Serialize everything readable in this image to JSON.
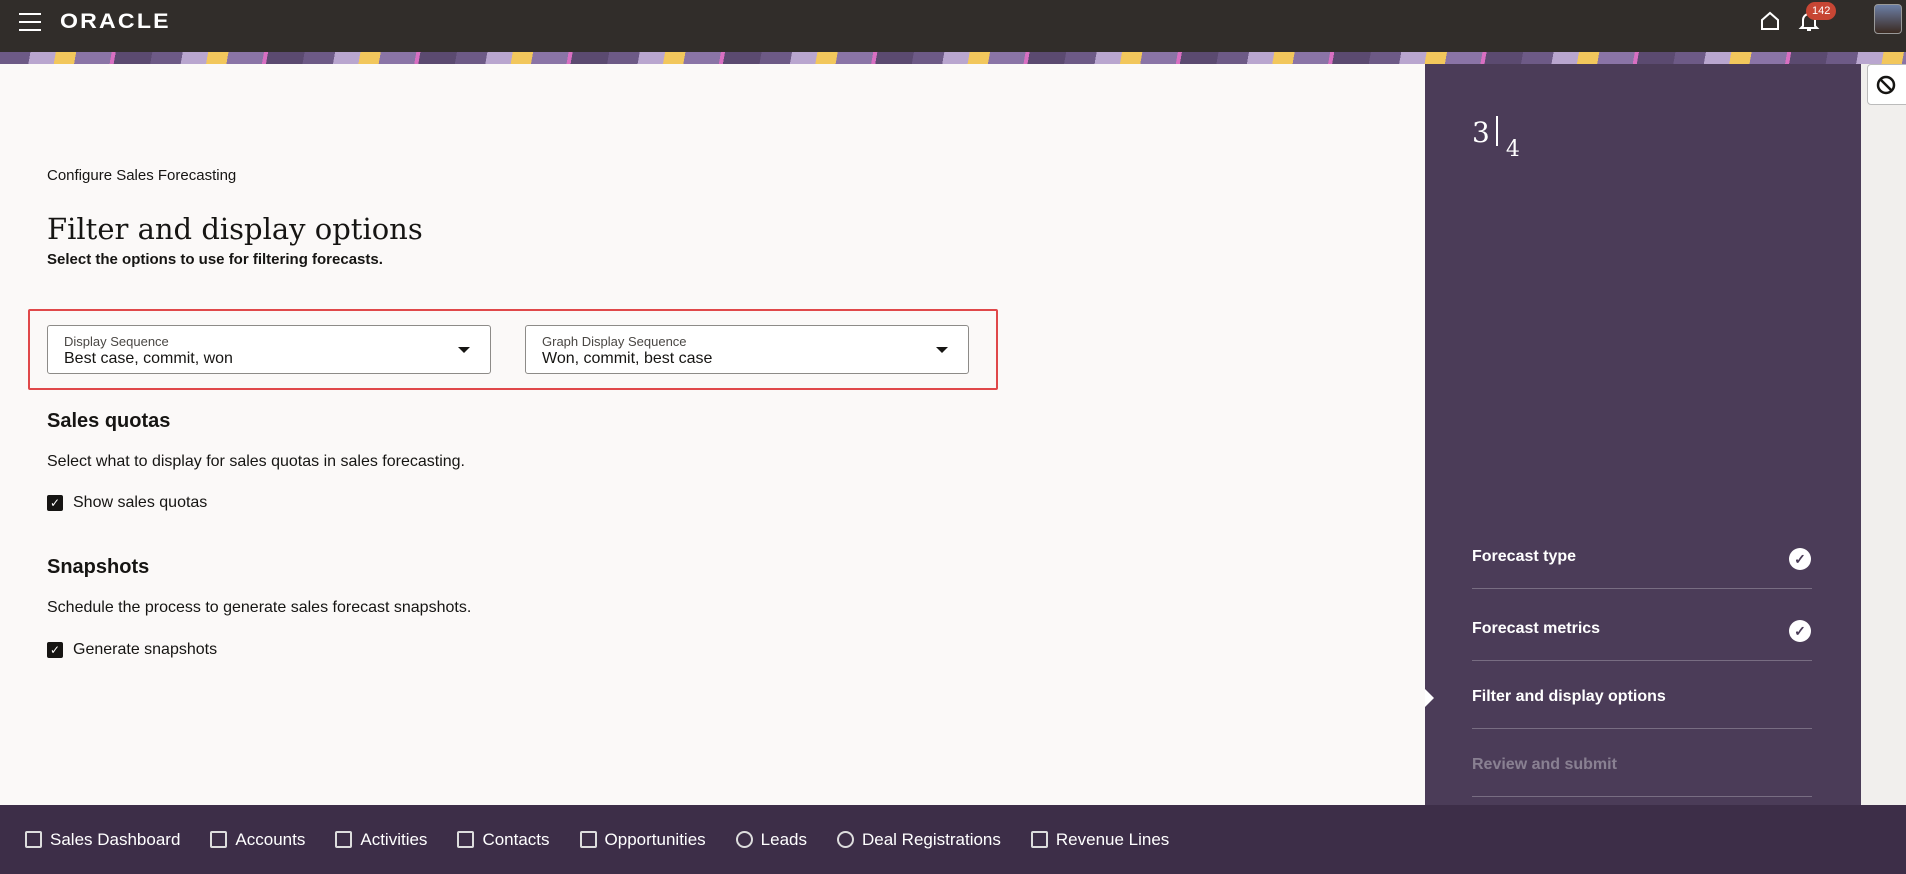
{
  "header": {
    "logo": "ORACLE",
    "notification_count": "142"
  },
  "page": {
    "breadcrumb": "Configure Sales Forecasting",
    "title": "Filter and display options",
    "subtitle": "Select the options to use for filtering forecasts."
  },
  "dropdowns": [
    {
      "label": "Display Sequence",
      "value": "Best case, commit, won"
    },
    {
      "label": "Graph Display Sequence",
      "value": "Won, commit, best case"
    }
  ],
  "sales_quotas": {
    "heading": "Sales quotas",
    "description": "Select what to display for sales quotas in sales forecasting.",
    "checkbox_label": "Show sales quotas",
    "checked": true
  },
  "snapshots": {
    "heading": "Snapshots",
    "description": "Schedule the process to generate sales forecast snapshots.",
    "checkbox_label": "Generate snapshots",
    "checked": true
  },
  "progress": {
    "current": "3",
    "total": "4",
    "steps": [
      {
        "label": "Forecast type",
        "status": "complete"
      },
      {
        "label": "Forecast metrics",
        "status": "complete"
      },
      {
        "label": "Filter and display options",
        "status": "current"
      },
      {
        "label": "Review and submit",
        "status": "pending"
      }
    ]
  },
  "bottom_nav": [
    {
      "label": "Sales Dashboard",
      "icon": "dashboard-icon"
    },
    {
      "label": "Accounts",
      "icon": "building-icon"
    },
    {
      "label": "Activities",
      "icon": "calendar-icon"
    },
    {
      "label": "Contacts",
      "icon": "contact-card-icon"
    },
    {
      "label": "Opportunities",
      "icon": "opportunity-icon"
    },
    {
      "label": "Leads",
      "icon": "leads-icon"
    },
    {
      "label": "Deal Registrations",
      "icon": "badge-icon"
    },
    {
      "label": "Revenue Lines",
      "icon": "box-icon"
    }
  ]
}
